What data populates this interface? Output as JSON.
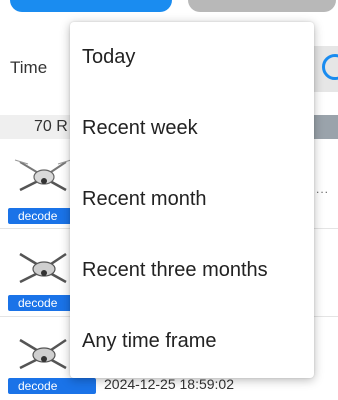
{
  "filter": {
    "time_label": "Time",
    "record_count": "70 R"
  },
  "rows": [
    {
      "decode_label": "decode",
      "timestamp": ""
    },
    {
      "decode_label": "decode",
      "timestamp": ""
    },
    {
      "decode_label": "decode",
      "timestamp": "2024-12-25 18:59:02"
    }
  ],
  "row_more": "...",
  "dropdown": {
    "items": [
      {
        "label": "Today"
      },
      {
        "label": "Recent week"
      },
      {
        "label": "Recent month"
      },
      {
        "label": "Recent three months"
      },
      {
        "label": "Any time frame"
      }
    ]
  },
  "colors": {
    "accent": "#1a8cf0",
    "decode_tag": "#1a73e8",
    "secondary_button": "#b8b8b8"
  },
  "icons": {
    "search": "search-icon",
    "drone": "drone-icon"
  }
}
